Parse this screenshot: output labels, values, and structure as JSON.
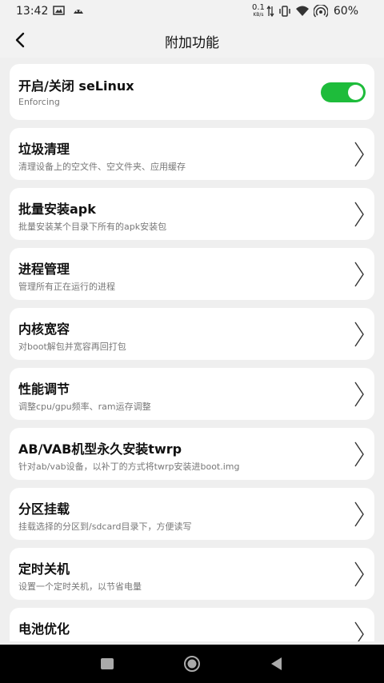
{
  "status_bar": {
    "time": "13:42",
    "net_speed_value": "0.1",
    "net_speed_unit": "KB/s",
    "battery": "60%"
  },
  "app_bar": {
    "title": "附加功能"
  },
  "items": [
    {
      "title": "开启/关闭 seLinux",
      "subtitle": "Enforcing",
      "toggle_on": true
    },
    {
      "title": "垃圾清理",
      "subtitle": "清理设备上的空文件、空文件夹、应用缓存"
    },
    {
      "title": "批量安装apk",
      "subtitle": "批量安装某个目录下所有的apk安装包"
    },
    {
      "title": "进程管理",
      "subtitle": "管理所有正在运行的进程"
    },
    {
      "title": "内核宽容",
      "subtitle": "对boot解包并宽容再回打包"
    },
    {
      "title": "性能调节",
      "subtitle": "调整cpu/gpu频率、ram运存调整"
    },
    {
      "title": "AB/VAB机型永久安装twrp",
      "subtitle": "针对ab/vab设备，以补丁的方式将twrp安装进boot.img"
    },
    {
      "title": "分区挂载",
      "subtitle": "挂载选择的分区到/sdcard目录下，方便读写"
    },
    {
      "title": "定时关机",
      "subtitle": "设置一个定时关机，以节省电量"
    },
    {
      "title": "电池优化",
      "subtitle": ""
    }
  ],
  "colors": {
    "toggle_on": "#1ebc3b",
    "background": "#efefef",
    "card": "#ffffff"
  },
  "icons": [
    "back-arrow-icon",
    "chevron-right-icon",
    "nav-recents-icon",
    "nav-home-icon",
    "nav-back-icon"
  ]
}
